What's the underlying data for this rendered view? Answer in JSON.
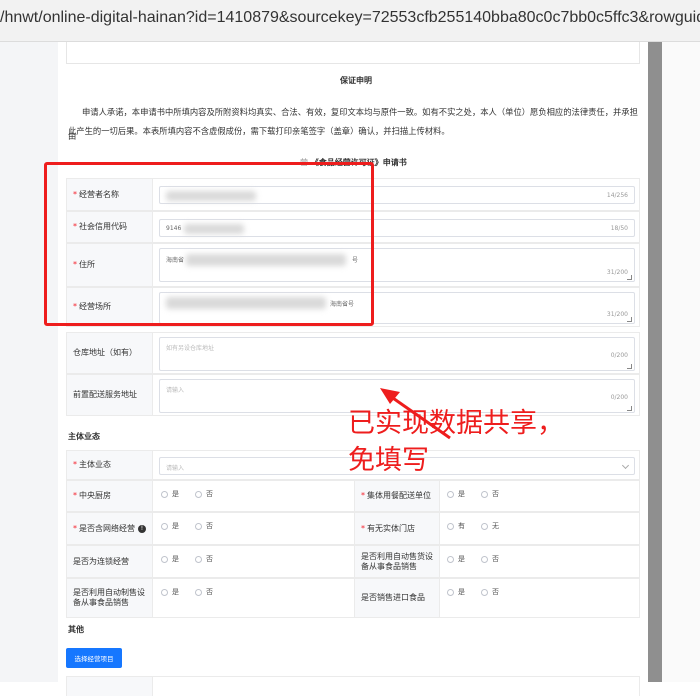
{
  "browser": {
    "url": "/hnwt/online-digital-hainan?id=1410879&sourcekey=72553cfb255140bba80c0c7bb0c5ffc3&rowguid=2"
  },
  "declaration": {
    "title": "保证申明",
    "text_line1": "申请人承诺，本申请书中所填内容及所附资料均真实、合法、有效，复印文本均与原件一致。如有不实之处，本人（单位）愿负相应的法律责任，并承担由",
    "text_line2": "此产生的一切后果。本表所填内容不含虚假成份，需下载打印亲笔签字（盖章）确认，并扫描上传材料。"
  },
  "form_title": "《食品经营许可证》申请书",
  "form_title_prefix": "营",
  "fields": {
    "operator_name": {
      "label": "经营者名称",
      "counter": "14/256"
    },
    "credit_code": {
      "label": "社会信用代码",
      "value_prefix": "9146",
      "counter": "18/50"
    },
    "address": {
      "label": "住所",
      "value_prefix": "海南省",
      "value_suffix": "号",
      "counter": "31/200"
    },
    "premises": {
      "label": "经营场所",
      "value_suffix": "海南省号",
      "counter": "31/200"
    },
    "warehouse": {
      "label": "仓库地址（如有）",
      "placeholder": "如有另设仓库地址",
      "counter": "0/200"
    },
    "delivery": {
      "label": "前置配送服务地址",
      "placeholder": "请输入",
      "counter": "0/200"
    }
  },
  "business_section": {
    "title": "主体业态",
    "main_business": {
      "label": "主体业态",
      "placeholder": "请输入"
    },
    "rows": [
      {
        "left_label": "中央厨房",
        "left_required": "*",
        "left_opts": [
          "是",
          "否"
        ],
        "right_label": "集体用餐配送单位",
        "right_required": "*",
        "right_opts": [
          "是",
          "否"
        ]
      },
      {
        "left_label": "是否含网络经营",
        "left_required": "*",
        "left_opts": [
          "是",
          "否"
        ],
        "right_label": "有无实体门店",
        "right_required": "*",
        "right_opts": [
          "有",
          "无"
        ]
      },
      {
        "left_label": "是否为连锁经营",
        "left_required": "",
        "left_opts": [
          "是",
          "否"
        ],
        "right_label": "是否利用自动售货设备从事食品销售",
        "right_required": "",
        "right_opts": [
          "是",
          "否"
        ]
      },
      {
        "left_label": "是否利用自动制售设备从事食品销售",
        "left_required": "",
        "left_opts": [
          "是",
          "否"
        ],
        "right_label": "是否销售进口食品",
        "right_required": "",
        "right_opts": [
          "是",
          "否"
        ]
      }
    ],
    "info_icon": "!"
  },
  "other_section": {
    "title": "其他",
    "select_button": "选择经营项目"
  },
  "required_mark": "*",
  "annotation": {
    "text": "已实现数据共享，免填写"
  },
  "colors": {
    "annotation_red": "#ee1d1d",
    "primary_blue": "#1677ff",
    "required_red": "#f5222d"
  }
}
